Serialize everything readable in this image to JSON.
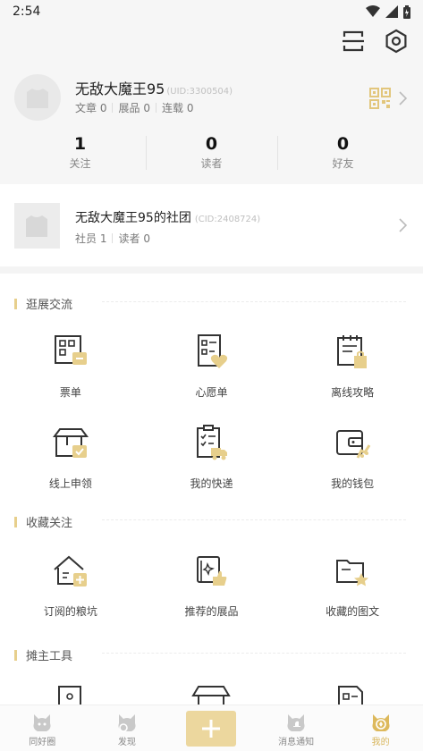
{
  "status_bar": {
    "time": "2:54",
    "icons": [
      "wifi-icon",
      "signal-icon",
      "battery-icon"
    ]
  },
  "header": {
    "icons": [
      "scan-icon",
      "settings-icon"
    ]
  },
  "profile": {
    "username": "无敌大魔王95",
    "uid": "(UID:3300504)",
    "stats": [
      {
        "label": "文章",
        "value": "0"
      },
      {
        "label": "展品",
        "value": "0"
      },
      {
        "label": "连载",
        "value": "0"
      }
    ],
    "counts": [
      {
        "value": "1",
        "label": "关注"
      },
      {
        "value": "0",
        "label": "读者"
      },
      {
        "value": "0",
        "label": "好友"
      }
    ]
  },
  "club": {
    "name": "无敌大魔王95的社团",
    "cid": "(CID:2408724)",
    "stats": [
      {
        "label": "社员",
        "value": "1"
      },
      {
        "label": "读者",
        "value": "0"
      }
    ]
  },
  "sections": [
    {
      "title": "逛展交流",
      "items": [
        {
          "label": "票单",
          "icon": "ticket-list-icon"
        },
        {
          "label": "心愿单",
          "icon": "wishlist-icon"
        },
        {
          "label": "离线攻略",
          "icon": "offline-guide-icon"
        },
        {
          "label": "线上申领",
          "icon": "online-claim-icon"
        },
        {
          "label": "我的快递",
          "icon": "my-delivery-icon"
        },
        {
          "label": "我的钱包",
          "icon": "my-wallet-icon"
        }
      ]
    },
    {
      "title": "收藏关注",
      "items": [
        {
          "label": "订阅的粮坑",
          "icon": "subscribed-pit-icon"
        },
        {
          "label": "推荐的展品",
          "icon": "recommended-exhibit-icon"
        },
        {
          "label": "收藏的图文",
          "icon": "collected-post-icon"
        }
      ]
    },
    {
      "title": "摊主工具",
      "items": [
        {
          "label": "",
          "icon": "booth-icon"
        },
        {
          "label": "",
          "icon": "stall-icon"
        },
        {
          "label": "",
          "icon": "document-icon"
        }
      ]
    }
  ],
  "tabbar": {
    "tabs": [
      {
        "label": "同好圈",
        "icon": "community-icon"
      },
      {
        "label": "发现",
        "icon": "discover-icon"
      },
      {
        "label": "",
        "icon": "plus-icon"
      },
      {
        "label": "消息通知",
        "icon": "notification-icon"
      },
      {
        "label": "我的",
        "icon": "me-icon"
      }
    ],
    "active": "我的"
  },
  "colors": {
    "accent": "#e7cf8c",
    "accent_dark": "#d8b65c",
    "background": "#f6f6f6"
  }
}
